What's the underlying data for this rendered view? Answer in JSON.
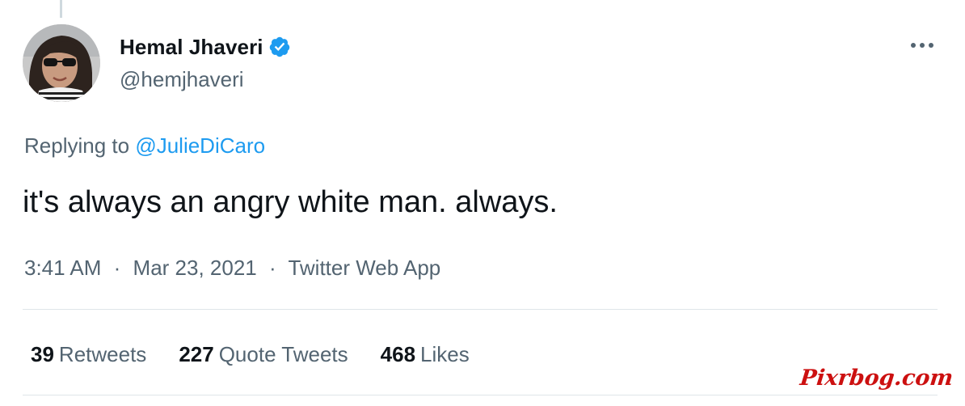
{
  "tweet": {
    "author": {
      "display_name": "Hemal Jhaveri",
      "handle": "@hemjhaveri",
      "verified": true,
      "avatar_icon": "profile-photo"
    },
    "more_icon": "more-horizontal-icon",
    "replying_to": {
      "prefix": "Replying to",
      "mention": "@JulieDiCaro"
    },
    "text": "it's always an angry white man. always.",
    "timestamp": {
      "time": "3:41 AM",
      "date": "Mar 23, 2021",
      "separator": "·",
      "source": "Twitter Web App"
    },
    "stats": [
      {
        "count": "39",
        "label": "Retweets"
      },
      {
        "count": "227",
        "label": "Quote Tweets"
      },
      {
        "count": "468",
        "label": "Likes"
      }
    ]
  },
  "watermark": "Pixrbog.com",
  "colors": {
    "primary_text": "#0f1419",
    "secondary_text": "#536471",
    "accent": "#1d9bf0",
    "divider": "#dfe5e9",
    "watermark": "#cc1010"
  }
}
